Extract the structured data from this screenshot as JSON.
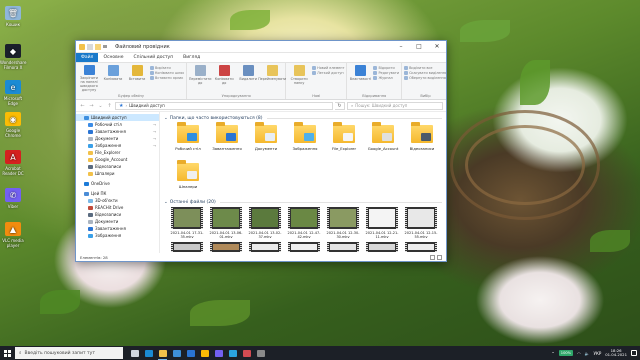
{
  "desktop": {
    "icons": [
      {
        "name": "recycle-bin-icon",
        "label": "Кошик",
        "color": "#8fb6d9",
        "glyph": "🗑"
      },
      {
        "name": "wondershare-icon",
        "label": "Wondershare Filmora X",
        "color": "#1a1f2b",
        "glyph": "◆"
      },
      {
        "name": "edge-icon",
        "label": "Microsoft Edge",
        "color": "#1b8bd4",
        "glyph": "e"
      },
      {
        "name": "chrome-icon",
        "label": "Google Chrome",
        "color": "#fbbc05",
        "glyph": "◉"
      },
      {
        "name": "acrobat-icon",
        "label": "Acrobat Reader DC",
        "color": "#d4201f",
        "glyph": "A"
      },
      {
        "name": "viber-icon",
        "label": "Viber",
        "color": "#7360f2",
        "glyph": "✆"
      },
      {
        "name": "vlc-icon",
        "label": "VLC media player",
        "color": "#f28c0f",
        "glyph": "▲"
      }
    ]
  },
  "window": {
    "title": "Файловий провідник",
    "controls": {
      "minimize": "–",
      "maximize": "□",
      "close": "✕"
    },
    "ribbon_tabs": [
      "Файл",
      "Основне",
      "Спільний доступ",
      "Вигляд"
    ],
    "ribbon": {
      "groups": [
        {
          "label": "Буфер обміну",
          "buttons": [
            "Закріпити на панелі швидкого доступу",
            "Копіювати",
            "Вставити"
          ],
          "small": [
            "Вирізати",
            "Копіювати шлях",
            "Вставити ярлик"
          ]
        },
        {
          "label": "Упорядкування",
          "buttons": [
            "Перемістити до",
            "Копіювати до",
            "Видалити",
            "Перейменувати"
          ],
          "small": []
        },
        {
          "label": "Нові",
          "buttons": [
            "Створити папку"
          ],
          "small": [
            "Новий елемент",
            "Легкий доступ"
          ]
        },
        {
          "label": "Відкривання",
          "buttons": [
            "Властивості"
          ],
          "small": [
            "Відкрити",
            "Редагувати",
            "Журнал"
          ]
        },
        {
          "label": "Вибір",
          "buttons": [],
          "small": [
            "Виділити все",
            "Скасувати виділення",
            "Обернути виділення"
          ]
        }
      ]
    },
    "address": {
      "path": "Швидкий доступ",
      "search_placeholder": "Пошук: Швидкий доступ"
    },
    "nav_pane": [
      {
        "label": "Швидкий доступ",
        "level": 1,
        "selected": true,
        "color": "#3d8fe0",
        "pin": false
      },
      {
        "label": "Робочий стіл",
        "level": 2,
        "color": "#3c8ce6",
        "pin": true
      },
      {
        "label": "Завантаження",
        "level": 2,
        "color": "#2a74d4",
        "pin": true
      },
      {
        "label": "Документи",
        "level": 2,
        "color": "#aab4c0",
        "pin": true
      },
      {
        "label": "Зображення",
        "level": 2,
        "color": "#3aa0e8",
        "pin": true
      },
      {
        "label": "File_Explorer",
        "level": 2,
        "color": "#f2c14a",
        "pin": false
      },
      {
        "label": "Google_Account",
        "level": 2,
        "color": "#f2c14a",
        "pin": false
      },
      {
        "label": "Відеозаписи",
        "level": 2,
        "color": "#5a6b80",
        "pin": false
      },
      {
        "label": "Шпалери",
        "level": 2,
        "color": "#f2c14a",
        "pin": false
      },
      {
        "label": "OneDrive",
        "level": 1,
        "color": "#1c7bd8",
        "pin": false
      },
      {
        "label": "Цей ПК",
        "level": 1,
        "color": "#4a8cd6",
        "pin": false
      },
      {
        "label": "3D-об'єкти",
        "level": 2,
        "color": "#7ab8e6",
        "pin": false
      },
      {
        "label": "REACHit Drive",
        "level": 2,
        "color": "#c24a3a",
        "pin": false
      },
      {
        "label": "Відеозаписи",
        "level": 2,
        "color": "#5a6b80",
        "pin": false
      },
      {
        "label": "Документи",
        "level": 2,
        "color": "#aab4c0",
        "pin": false
      },
      {
        "label": "Завантаження",
        "level": 2,
        "color": "#2a74d4",
        "pin": false
      },
      {
        "label": "Зображення",
        "level": 2,
        "color": "#3aa0e8",
        "pin": false
      }
    ],
    "frequent": {
      "header": "Папки, що часто використовуються (8)",
      "items": [
        {
          "label": "Робочий стіл",
          "badge": "#2f8fe0"
        },
        {
          "label": "Завантаження",
          "badge": "#2a74d4"
        },
        {
          "label": "Документи",
          "badge": "#e8eef5"
        },
        {
          "label": "Зображення",
          "badge": "#4fb0ea"
        },
        {
          "label": "File_Explorer",
          "badge": "#f5f5f5"
        },
        {
          "label": "Google_Account",
          "badge": "#e0e0e0"
        },
        {
          "label": "Відеозаписи",
          "badge": "#4a5a6a"
        },
        {
          "label": "Шпалери",
          "badge": "#f0f0f0"
        }
      ]
    },
    "recent": {
      "header": "Останні файли (20)",
      "items": [
        {
          "label": "2021-04-01 17-31-35.mkv",
          "color": "#7d8f5a"
        },
        {
          "label": "2021-04-01 13-06-01.mkv",
          "color": "#6d8a4a"
        },
        {
          "label": "2021-04-01 13-02-37.mkv",
          "color": "#5b7a3d"
        },
        {
          "label": "2021-04-01 12-47-42.mkv",
          "color": "#6a8844"
        },
        {
          "label": "2021-04-01 12-30-30.mkv",
          "color": "#8a9a62"
        },
        {
          "label": "2021-04-01 12-21-11.mkv",
          "color": "#f4f4f4"
        },
        {
          "label": "2021-04-01 12-15-55.mkv",
          "color": "#e8e8e8"
        }
      ],
      "row2_colors": [
        "#c9c9c9",
        "#b08a5a",
        "#ececec",
        "#f0f0f0",
        "#e4e4e4",
        "#d8d8d8",
        "#ededed"
      ]
    },
    "status": "Елементів: 28"
  },
  "taskbar": {
    "search_placeholder": "Введіть пошуковий запит тут",
    "apps": [
      {
        "name": "task-view-icon",
        "color": "#cfd6de",
        "active": false
      },
      {
        "name": "edge-taskbar-icon",
        "color": "#1b8bd4",
        "active": false
      },
      {
        "name": "file-explorer-taskbar-icon",
        "color": "#f2c14a",
        "active": true
      },
      {
        "name": "store-taskbar-icon",
        "color": "#3e8fd8",
        "active": false
      },
      {
        "name": "mail-taskbar-icon",
        "color": "#2a74d4",
        "active": false
      },
      {
        "name": "chrome-taskbar-icon",
        "color": "#fbbc05",
        "active": false
      },
      {
        "name": "viber-taskbar-icon",
        "color": "#7360f2",
        "active": false
      },
      {
        "name": "telegram-taskbar-icon",
        "color": "#2aa3e0",
        "active": false
      },
      {
        "name": "photos-taskbar-icon",
        "color": "#d24b52",
        "active": false
      },
      {
        "name": "settings-taskbar-icon",
        "color": "#8a8a8a",
        "active": false
      }
    ],
    "battery": "100%",
    "language": "УКР",
    "time": "18:26",
    "date": "01.04.2021"
  }
}
